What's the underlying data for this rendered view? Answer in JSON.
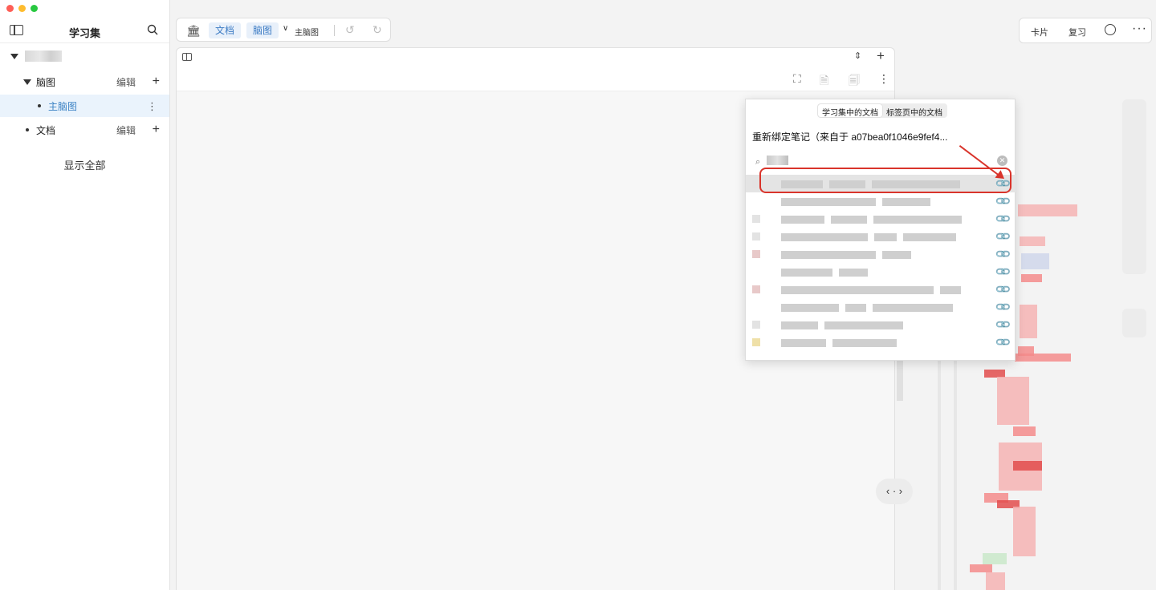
{
  "sidebar": {
    "title": "学习集",
    "items": [
      {
        "label": "",
        "blurred": true
      },
      {
        "label": "脑图",
        "edit": "编辑",
        "add": "+"
      },
      {
        "label": "主脑图",
        "more": "⋮"
      },
      {
        "label": "文档",
        "edit": "编辑",
        "add": "+"
      }
    ],
    "show_all": "显示全部"
  },
  "toolbar": {
    "bank_icon": "🏛",
    "tab_doc": "文档",
    "tab_mindmap": "脑图",
    "chevron": "∨",
    "current": "主脑图",
    "undo": "↺",
    "redo": "↻"
  },
  "toolbar_right": {
    "card": "卡片",
    "review": "复习",
    "more": "···"
  },
  "doc_panel": {
    "sort_icon": "⇕",
    "add": "+",
    "icons": [
      "⛶",
      "🗎",
      "🗐",
      "⋮"
    ]
  },
  "popover": {
    "seg_tabs": [
      "学习集中的文档",
      "标签页中的文档"
    ],
    "title": "重新绑定笔记（来自于 a07bea0f1046e9fef4...",
    "search_icon": "⌕",
    "clear_icon": "✕",
    "link_icon": "🔗",
    "rows": 10
  },
  "nav": {
    "label": "‹ · ›"
  },
  "colors": {
    "accent": "#3b7bc4",
    "highlight": "#d9342b",
    "active_bg": "#eaf3fc"
  }
}
